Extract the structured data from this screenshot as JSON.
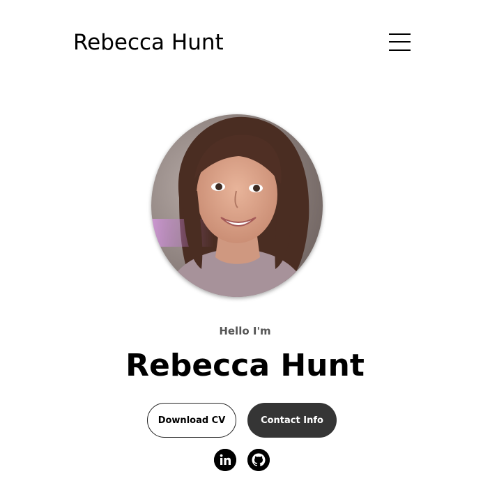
{
  "header": {
    "site_title": "Rebecca Hunt",
    "menu_icon": "hamburger-menu-icon"
  },
  "profile": {
    "photo_alt": "Rebecca Hunt profile picture",
    "greeting": "Hello I'm",
    "name": "Rebecca Hunt"
  },
  "buttons": {
    "download_cv": "Download CV",
    "contact_info": "Contact Info"
  },
  "social": [
    {
      "name": "LinkedIn",
      "icon": "linkedin-icon"
    },
    {
      "name": "GitHub",
      "icon": "github-icon"
    }
  ],
  "colors": {
    "background": "#ffffff",
    "text": "#000000",
    "greeting": "#555555",
    "contact_button": "#353535"
  }
}
